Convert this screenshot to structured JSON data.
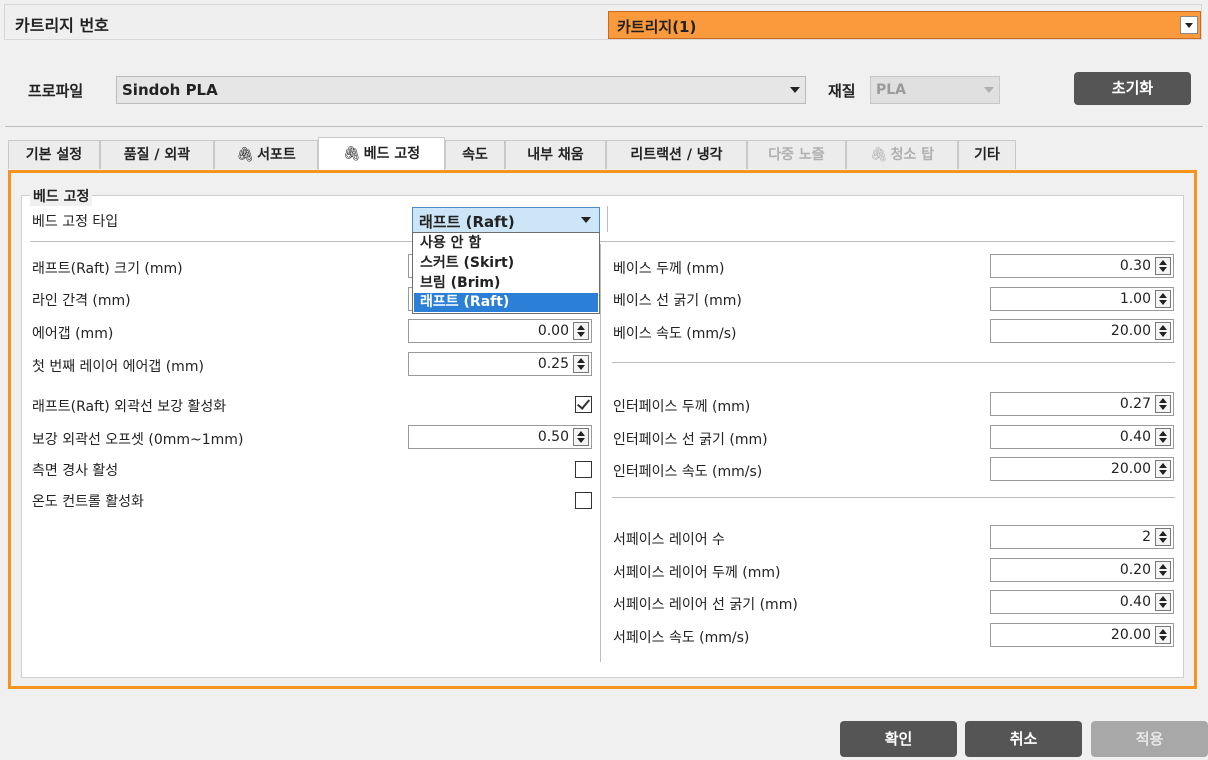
{
  "cartridge": {
    "label": "카트리지 번호",
    "selected": "카트리지(1)",
    "accent": "#fb9a3c"
  },
  "profile": {
    "label": "프로파일",
    "selected": "Sindoh PLA",
    "material_label": "재질",
    "material_value": "PLA",
    "reset_button": "초기화"
  },
  "tabs": [
    {
      "label": "기본 설정",
      "icon": "",
      "state": "normal"
    },
    {
      "label": "품질 / 외곽",
      "icon": "",
      "state": "normal"
    },
    {
      "label": "서포트",
      "icon": "paperclip-icon",
      "state": "normal"
    },
    {
      "label": "베드 고정",
      "icon": "paperclip-icon",
      "state": "active"
    },
    {
      "label": "속도",
      "icon": "",
      "state": "normal"
    },
    {
      "label": "내부 채움",
      "icon": "",
      "state": "normal"
    },
    {
      "label": "리트랙션 / 냉각",
      "icon": "",
      "state": "normal"
    },
    {
      "label": "다중 노즐",
      "icon": "",
      "state": "disabled"
    },
    {
      "label": "청소 탑",
      "icon": "paperclip-icon",
      "state": "disabled"
    },
    {
      "label": "기타",
      "icon": "",
      "state": "normal"
    }
  ],
  "group": {
    "title": "베드 고정"
  },
  "bed_type": {
    "label": "베드 고정 타입",
    "selected": "래프트 (Raft)",
    "options": [
      "사용 안 함",
      "스커트 (Skirt)",
      "브림 (Brim)",
      "래프트 (Raft)"
    ]
  },
  "left": {
    "raft_size_label": "래프트(Raft) 크기 (mm)",
    "line_spacing_label": "라인 간격 (mm)",
    "air_gap_label": "에어갭 (mm)",
    "air_gap_value": "0.00",
    "first_layer_gap_label": "첫 번째 레이어 에어갭 (mm)",
    "first_layer_gap_value": "0.25",
    "raft_outline_label": "래프트(Raft) 외곽선 보강 활성화",
    "raft_outline_checked": true,
    "outline_offset_label": "보강 외곽선 오프셋 (0mm~1mm)",
    "outline_offset_value": "0.50",
    "side_slope_label": "측면 경사 활성",
    "side_slope_checked": false,
    "temp_control_label": "온도 컨트롤 활성화",
    "temp_control_checked": false
  },
  "right": {
    "base_thickness_label": "베이스 두께 (mm)",
    "base_thickness_value": "0.30",
    "base_line_width_label": "베이스 선 굵기 (mm)",
    "base_line_width_value": "1.00",
    "base_speed_label": "베이스 속도 (mm/s)",
    "base_speed_value": "20.00",
    "interface_thickness_label": "인터페이스 두께 (mm)",
    "interface_thickness_value": "0.27",
    "interface_line_width_label": "인터페이스 선 굵기 (mm)",
    "interface_line_width_value": "0.40",
    "interface_speed_label": "인터페이스 속도 (mm/s)",
    "interface_speed_value": "20.00",
    "surface_layers_label": "서페이스 레이어 수",
    "surface_layers_value": "2",
    "surface_thickness_label": "서페이스 레이어 두께 (mm)",
    "surface_thickness_value": "0.20",
    "surface_line_width_label": "서페이스 레이어 선 굵기 (mm)",
    "surface_line_width_value": "0.40",
    "surface_speed_label": "서페이스 속도 (mm/s)",
    "surface_speed_value": "20.00"
  },
  "footer": {
    "ok": "확인",
    "cancel": "취소",
    "apply": "적용"
  }
}
